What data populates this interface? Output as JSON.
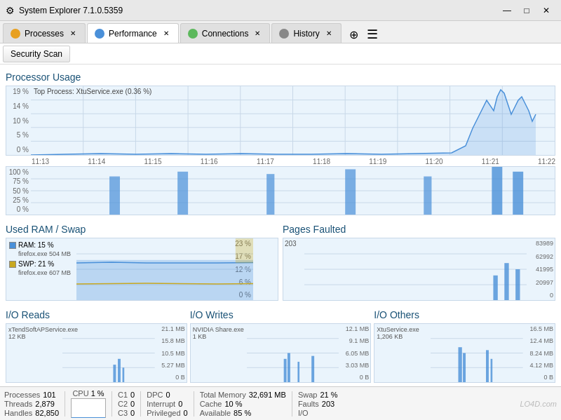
{
  "titlebar": {
    "icon": "⚙",
    "title": "System Explorer 7.1.0.5359",
    "controls": {
      "minimize": "—",
      "maximize": "□",
      "close": "✕"
    }
  },
  "tabs": [
    {
      "id": "processes",
      "label": "Processes",
      "icon_color": "#e8a020",
      "active": false
    },
    {
      "id": "performance",
      "label": "Performance",
      "icon_color": "#4a90d9",
      "active": true
    },
    {
      "id": "connections",
      "label": "Connections",
      "icon_color": "#5cb85c",
      "active": false
    },
    {
      "id": "history",
      "label": "History",
      "icon_color": "#888",
      "active": false
    }
  ],
  "toolbar": {
    "security_scan": "Security Scan"
  },
  "sections": {
    "processor": {
      "title": "Processor Usage",
      "top_process": "Top Process: XtuService.exe (0.36 %)",
      "yaxis_main": [
        "19 %",
        "14 %",
        "10 %",
        "5 %",
        "0 %"
      ],
      "yaxis_core": [
        "100 %",
        "75 %",
        "50 %",
        "25 %",
        "0 %"
      ],
      "xaxis": [
        "11:13",
        "11:14",
        "11:15",
        "11:16",
        "11:17",
        "11:18",
        "11:19",
        "11:20",
        "11:21",
        "11:22"
      ]
    },
    "ram": {
      "title": "Used RAM / Swap",
      "yaxis": [
        "23 %",
        "17 %",
        "12 %",
        "6 %",
        "0 %"
      ],
      "legend": [
        {
          "color": "#4a90d9",
          "label": "RAM: 15 %",
          "sub": "firefox.exe 504 MB"
        },
        {
          "color": "#c8a820",
          "label": "SWP: 21 %",
          "sub": "firefox.exe 607 MB"
        }
      ]
    },
    "pages": {
      "title": "Pages Faulted",
      "value": "203",
      "yaxis": [
        "83989",
        "62992",
        "41995",
        "20997",
        "0"
      ]
    },
    "io_reads": {
      "title": "I/O Reads",
      "process": "xTendSoftAPService.exe",
      "value": "12 KB",
      "yaxis": [
        "21.1 MB",
        "15.8 MB",
        "10.5 MB",
        "5.27 MB",
        "0 B"
      ]
    },
    "io_writes": {
      "title": "I/O Writes",
      "process": "NVIDIA Share.exe",
      "value": "1 KB",
      "yaxis": [
        "12.1 MB",
        "9.1 MB",
        "6.05 MB",
        "3.03 MB",
        "0 B"
      ]
    },
    "io_others": {
      "title": "I/O Others",
      "process": "XtuService.exe",
      "value": "1,206 KB",
      "yaxis": [
        "16.5 MB",
        "12.4 MB",
        "8.24 MB",
        "4.12 MB",
        "0 B"
      ]
    }
  },
  "statusbar": {
    "processes_label": "Processes",
    "processes_value": "101",
    "threads_label": "Threads",
    "threads_value": "2,879",
    "handles_label": "Handles",
    "handles_value": "82,850",
    "cpu_label": "CPU",
    "cpu_value": "1 %",
    "c1_label": "C1",
    "c1_value": "0",
    "c2_label": "C2",
    "c2_value": "0",
    "c3_label": "C3",
    "c3_value": "0",
    "dpc_label": "DPC",
    "dpc_value": "0",
    "interrupt_label": "Interrupt",
    "interrupt_value": "0",
    "privileged_label": "Privileged",
    "privileged_value": "0",
    "total_mem_label": "Total Memory",
    "total_mem_value": "32,691 MB",
    "cache_label": "Cache",
    "cache_value": "10 %",
    "available_label": "Available",
    "available_value": "85 %",
    "swap_label": "Swap",
    "swap_value": "21 %",
    "faults_label": "Faults",
    "faults_value": "203",
    "io_label": "I/O"
  },
  "watermark": "LO4D.com"
}
